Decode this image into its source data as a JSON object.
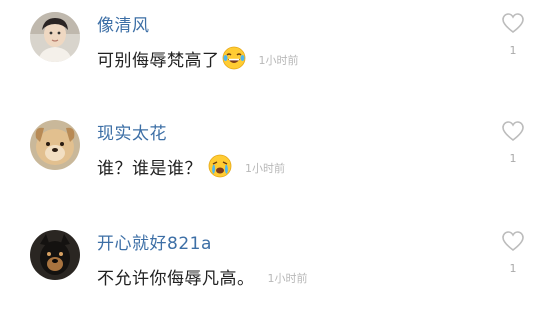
{
  "comments": [
    {
      "username": "像清风",
      "text": "可别侮辱梵高了",
      "emoji": "laughing-tears-emoji",
      "time": "1小时前",
      "likes": "1"
    },
    {
      "username": "现实太花",
      "text": "谁？谁是谁？",
      "emoji": "crying-emoji",
      "time": "1小时前",
      "likes": "1"
    },
    {
      "username": "开心就好821a",
      "text": "不允许你侮辱凡高。",
      "emoji": "",
      "time": "1小时前",
      "likes": "1"
    }
  ],
  "colors": {
    "username": "#3d6fa6",
    "text": "#222222",
    "meta": "#b8b8b8",
    "heart": "#bcbcbc"
  },
  "icons": {
    "like": "heart-outline-icon"
  }
}
